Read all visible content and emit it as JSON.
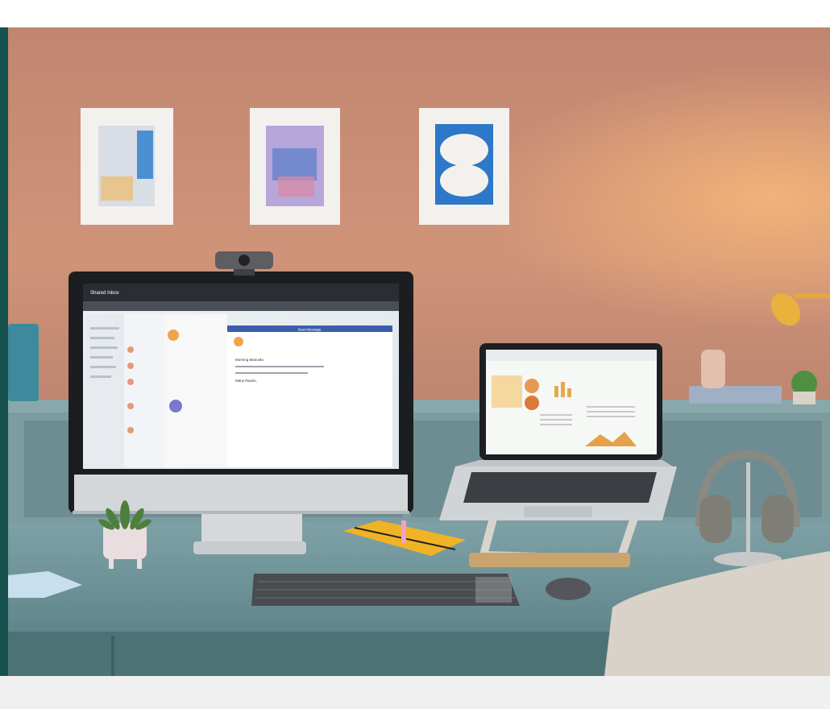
{
  "colors": {
    "wall": "#c98f74",
    "cabinet": "#7f9ea0",
    "desk": "#6f9398",
    "accent_teal": "#16514e",
    "page_bg": "#ffffff",
    "footer_band": "#f0f0f0"
  },
  "screens": {
    "monitor_title": "Shared Inbox",
    "compose_label": "New Message",
    "email_greeting": "Morning Manuela",
    "email_signoff": "Many thanks,"
  }
}
